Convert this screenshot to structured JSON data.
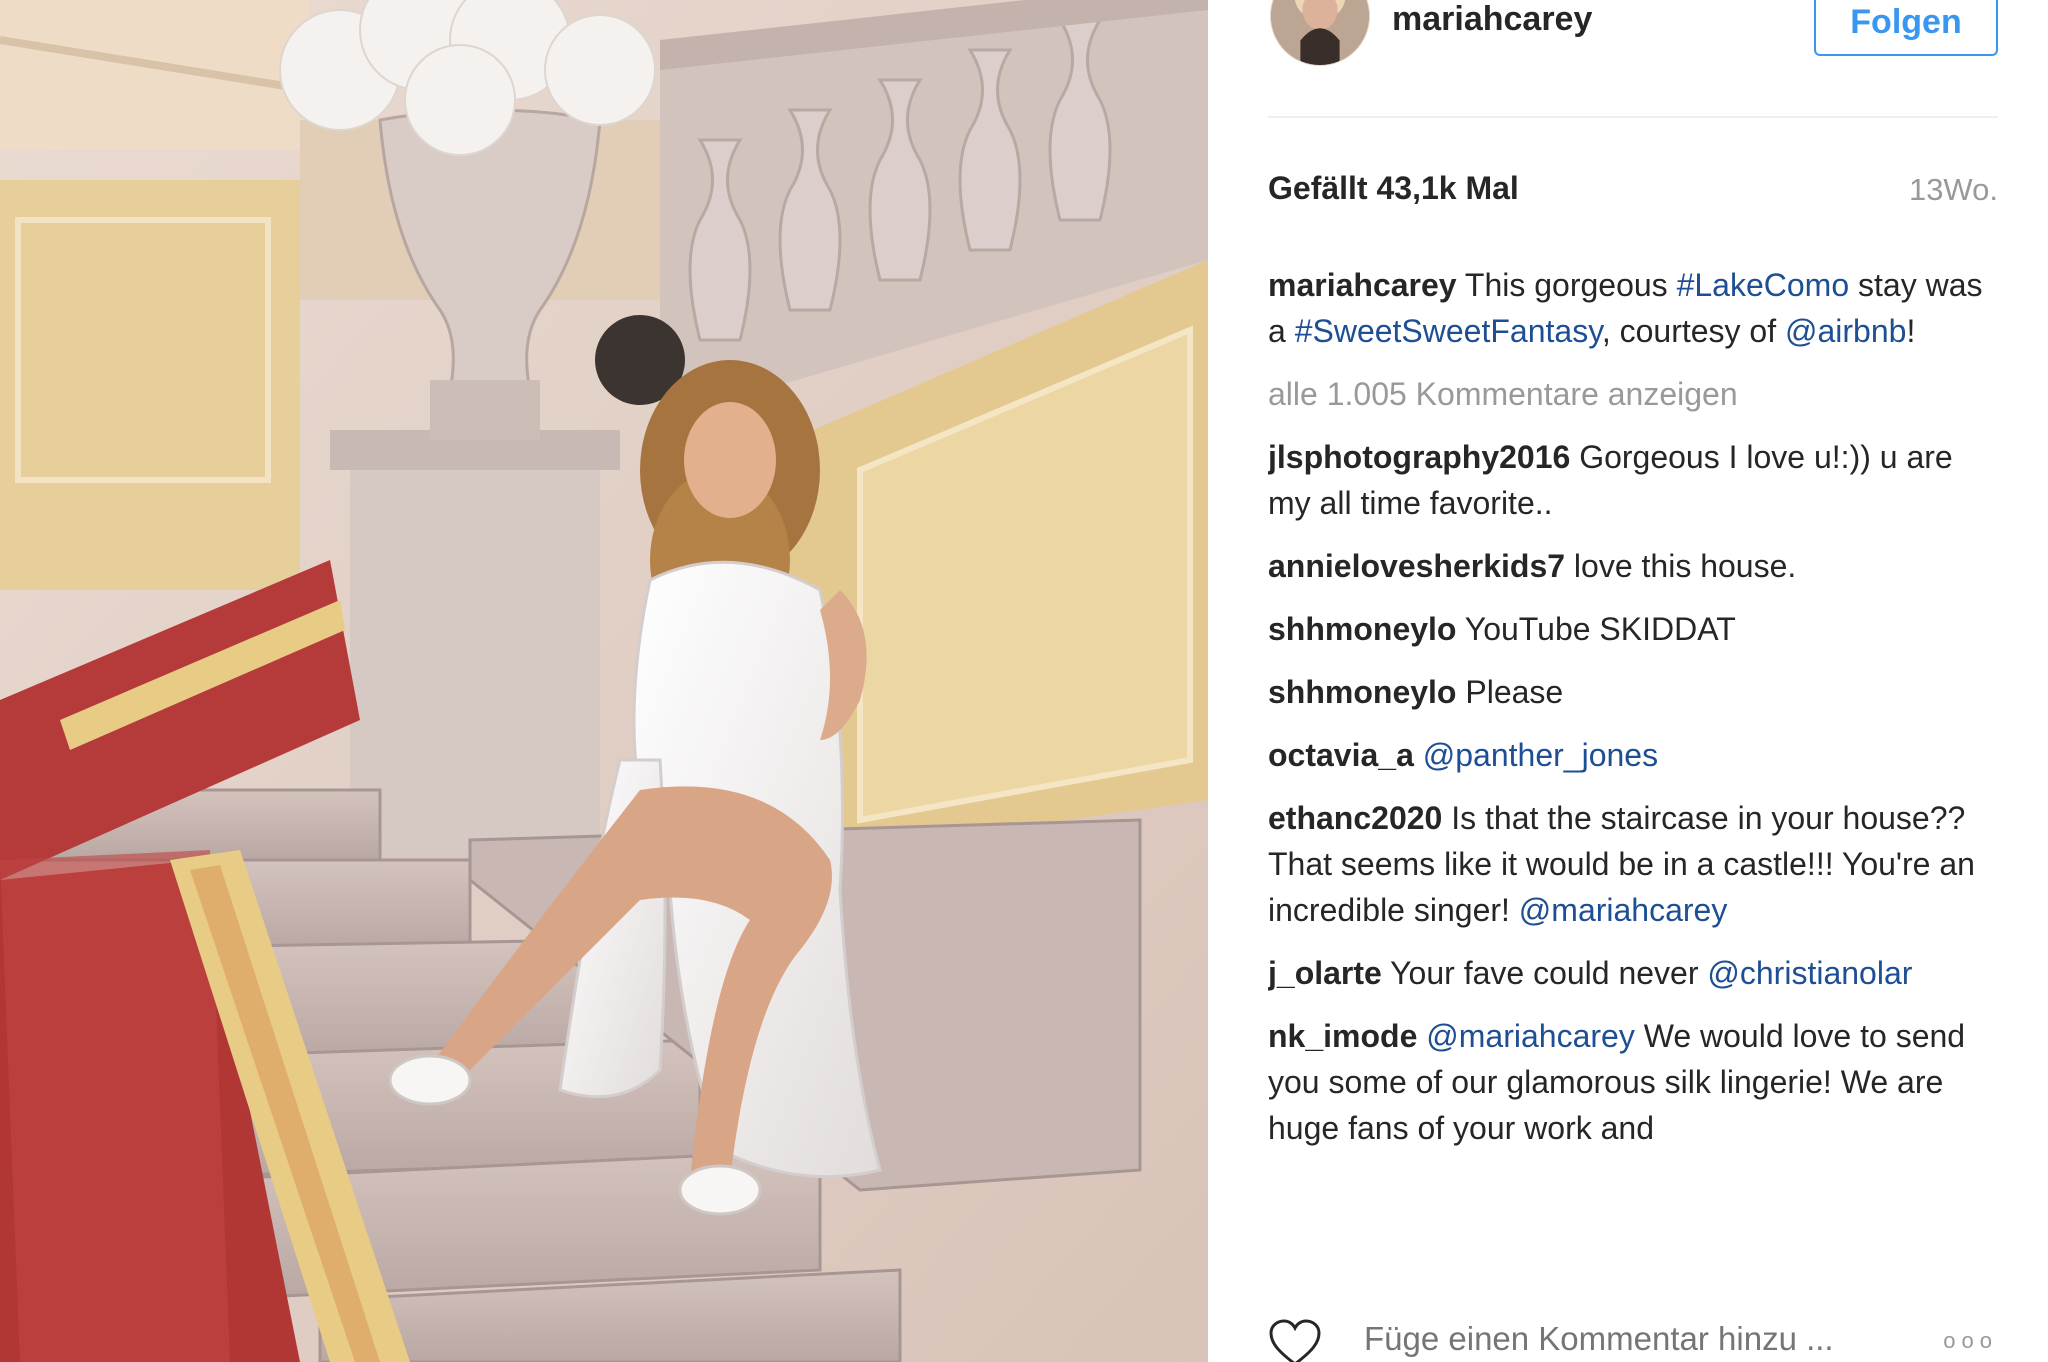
{
  "post": {
    "username": "mariahcarey",
    "follow_label": "Folgen",
    "likes": "Gefällt 43,1k Mal",
    "time": "13Wo.",
    "view_all": "alle 1.005 Kommentare anzeigen",
    "comment_placeholder": "Füge einen Kommentar hinzu ...",
    "more_label": "ooo"
  },
  "caption": {
    "user": "mariahcarey",
    "parts": [
      {
        "t": " This gorgeous "
      },
      {
        "t": "#LakeComo",
        "tag": true
      },
      {
        "t": " stay was a "
      },
      {
        "t": "#SweetSweetFantasy",
        "tag": true
      },
      {
        "t": ", courtesy of "
      },
      {
        "t": "@airbnb",
        "tag": true
      },
      {
        "t": "!"
      }
    ]
  },
  "comments": [
    {
      "user": "jlsphotography2016",
      "parts": [
        {
          "t": " Gorgeous I love u!:)) u are my all time favorite.."
        }
      ]
    },
    {
      "user": "annielovesherkids7",
      "parts": [
        {
          "t": " love this house."
        }
      ]
    },
    {
      "user": "shhmoneylo",
      "parts": [
        {
          "t": " YouTube SKIDDAT"
        }
      ]
    },
    {
      "user": "shhmoneylo",
      "parts": [
        {
          "t": " Please"
        }
      ]
    },
    {
      "user": "octavia_a",
      "parts": [
        {
          "t": " "
        },
        {
          "t": "@panther_jones",
          "tag": true
        }
      ]
    },
    {
      "user": "ethanc2020",
      "parts": [
        {
          "t": " Is that the staircase in your house?? That seems like it would be in a castle!!! You're an incredible singer! "
        },
        {
          "t": "@mariahcarey",
          "tag": true
        }
      ]
    },
    {
      "user": "j_olarte",
      "parts": [
        {
          "t": " Your fave could never "
        },
        {
          "t": "@christianolar",
          "tag": true
        }
      ]
    },
    {
      "user": "nk_imode",
      "parts": [
        {
          "t": " "
        },
        {
          "t": "@mariahcarey",
          "tag": true
        },
        {
          "t": " We would love to send you some of our glamorous silk lingerie! We are huge fans of your work and"
        }
      ]
    }
  ],
  "icons": {
    "like": "heart-icon",
    "more": "more-options-icon",
    "avatar": "profile-avatar"
  },
  "colors": {
    "link": "#1e4e93",
    "follow": "#3897f0",
    "muted": "#999999",
    "text": "#262626"
  }
}
